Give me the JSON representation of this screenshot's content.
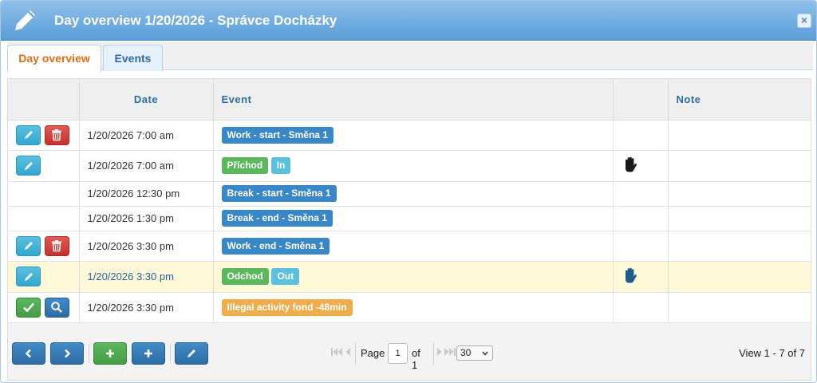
{
  "window": {
    "title": "Day overview 1/20/2026 - Správce Docházky",
    "close_label": "×"
  },
  "tabs": [
    {
      "label": "Day overview",
      "active": true
    },
    {
      "label": "Events",
      "active": false
    }
  ],
  "table": {
    "columns": [
      "",
      "Date",
      "Event",
      "",
      "Note"
    ],
    "rows": [
      {
        "actions": [
          "edit",
          "delete"
        ],
        "date": "1/20/2026 7:00 am",
        "events": [
          {
            "text": "Work - start - Směna 1",
            "color": "blue"
          }
        ],
        "hand": false,
        "note": ""
      },
      {
        "actions": [
          "edit"
        ],
        "date": "1/20/2026 7:00 am",
        "events": [
          {
            "text": "Příchod",
            "color": "green"
          },
          {
            "text": "In",
            "color": "cyan"
          }
        ],
        "hand": "black",
        "note": ""
      },
      {
        "actions": [],
        "date": "1/20/2026 12:30 pm",
        "events": [
          {
            "text": "Break - start - Směna 1",
            "color": "blue"
          }
        ],
        "hand": false,
        "note": ""
      },
      {
        "actions": [],
        "date": "1/20/2026 1:30 pm",
        "events": [
          {
            "text": "Break - end - Směna 1",
            "color": "blue"
          }
        ],
        "hand": false,
        "note": ""
      },
      {
        "actions": [
          "edit",
          "delete"
        ],
        "date": "1/20/2026 3:30 pm",
        "events": [
          {
            "text": "Work - end - Směna 1",
            "color": "blue"
          }
        ],
        "hand": false,
        "note": ""
      },
      {
        "actions": [
          "edit"
        ],
        "date": "1/20/2026 3:30 pm",
        "events": [
          {
            "text": "Odchod",
            "color": "green"
          },
          {
            "text": "Out",
            "color": "cyan"
          }
        ],
        "hand": "blue",
        "note": "",
        "highlighted": true
      },
      {
        "actions": [
          "approve",
          "search"
        ],
        "date": "1/20/2026 3:30 pm",
        "events": [
          {
            "text": "Illegal activity fond -48min",
            "color": "orange"
          }
        ],
        "hand": false,
        "note": ""
      }
    ]
  },
  "pager": {
    "page_label": "Page",
    "page_value": "1",
    "of_label": "of 1",
    "rows_per_page": "30",
    "view_info": "View 1 - 7 of 7"
  },
  "colors": {
    "title_bar": "#5a9dd8",
    "active_tab_text": "#e26d12",
    "label_blue": "#3a87c8",
    "label_green": "#5cb85c",
    "label_cyan": "#5bc0de",
    "label_orange": "#f0ad4e",
    "highlight_row": "#fcf8d8"
  },
  "icons": {
    "title": "pencil-icon",
    "row_actions": [
      "pencil-icon",
      "trash-icon",
      "check-icon",
      "search-icon"
    ],
    "hand": "hand-icon",
    "footer": [
      "chevron-left-icon",
      "chevron-right-icon",
      "plus-icon",
      "plus-icon",
      "pencil-icon"
    ]
  }
}
